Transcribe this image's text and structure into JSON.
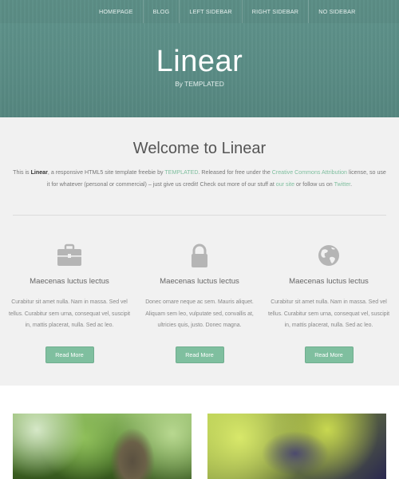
{
  "nav": {
    "items": [
      "HOMEPAGE",
      "BLOG",
      "LEFT SIDEBAR",
      "RIGHT SIDEBAR",
      "NO SIDEBAR"
    ]
  },
  "header": {
    "logo": "Linear",
    "byline": "By TEMPLATED"
  },
  "welcome": {
    "title": "Welcome to Linear",
    "intro": {
      "t1": "This is ",
      "brand": "Linear",
      "t2": ", a responsive HTML5 site template freebie by ",
      "link_templated": "TEMPLATED",
      "t3": ". Released for free under the ",
      "link_license": "Creative Commons Attribution",
      "t4": " license, so use it for whatever (personal or commercial) – just give us credit! Check out more of our stuff at ",
      "link_site": "our site",
      "t5": " or follow us on ",
      "link_twitter": "Twitter",
      "t6": "."
    }
  },
  "features": [
    {
      "icon": "briefcase-icon",
      "title": "Maecenas luctus lectus",
      "text": "Curabitur sit amet nulla. Nam in massa. Sed vel tellus. Curabitur sem urna, consequat vel, suscipit in, mattis placerat, nulla. Sed ac leo.",
      "button": "Read More"
    },
    {
      "icon": "lock-icon",
      "title": "Maecenas luctus lectus",
      "text": "Donec ornare neque ac sem. Mauris aliquet. Aliquam sem leo, vulputate sed, convallis at, ultricies quis, justo. Donec magna.",
      "button": "Read More"
    },
    {
      "icon": "globe-icon",
      "title": "Maecenas luctus lectus",
      "text": "Curabitur sit amet nulla. Nam in massa. Sed vel tellus. Curabitur sem urna, consequat vel, suscipit in, mattis placerat, nulla. Sed ac leo.",
      "button": "Read More"
    }
  ],
  "colors": {
    "header": "#5a8c85",
    "accent": "#7fbf9f",
    "section_bg": "#f1f1f1",
    "icon": "#b5b5b5"
  }
}
